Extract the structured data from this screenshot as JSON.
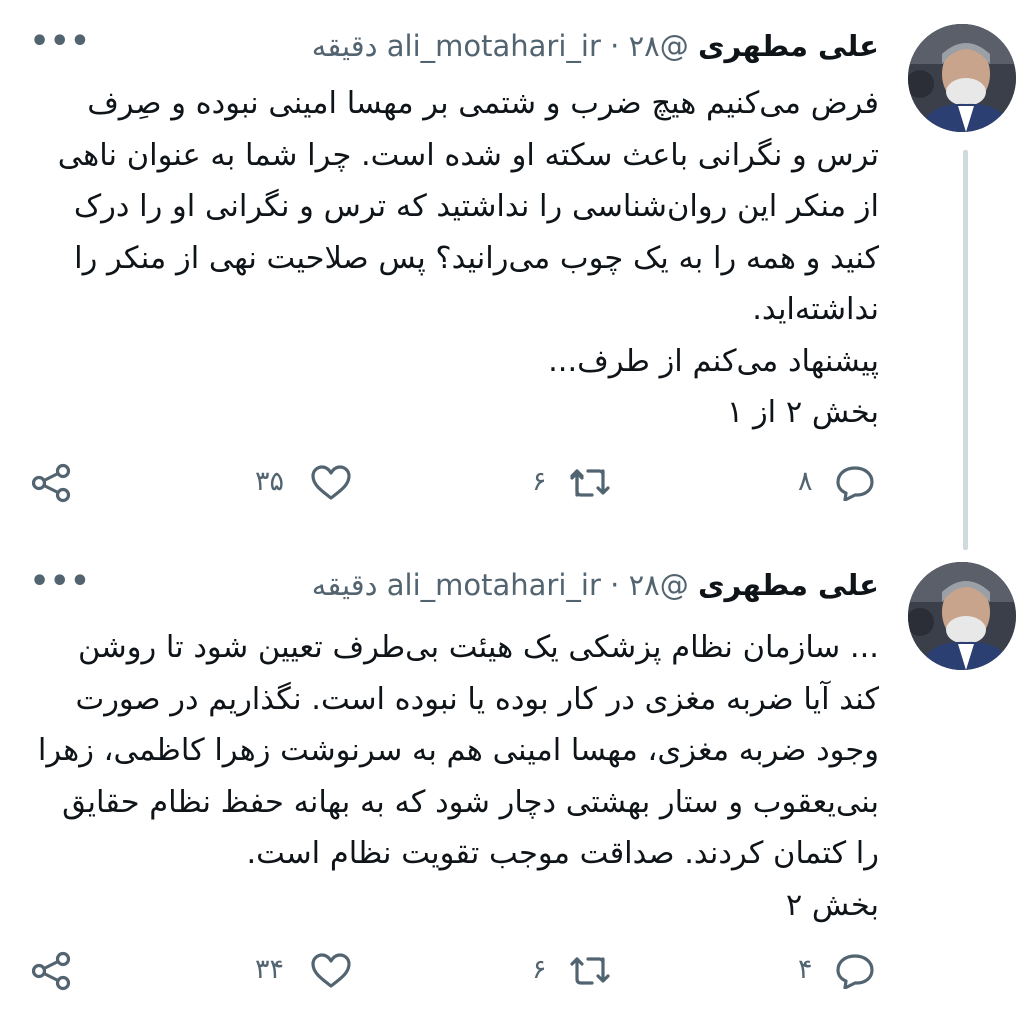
{
  "tweets": [
    {
      "author_name": "علی مطهری",
      "handle": "@ali_motahari_ir",
      "separator": "·",
      "time": "۲۸ دقیقه",
      "more_icon": "more-dots-icon",
      "lines": [
        "فرض می‌کنیم هیچ ضرب و شتمی بر مهسا امینی نبوده و صِرف",
        "ترس و نگرانی باعث سکته او شده است. چرا شما به عنوان ناهی",
        "از منکر این روان‌شناسی را نداشتید که ترس و نگرانی او را درک",
        "کنید و همه را به یک چوب می‌رانید؟ پس صلاحیت نهی از منکر را",
        "نداشته‌اید.",
        "پیشنهاد می‌کنم از طرف...",
        "بخش ۲ از ۱"
      ],
      "replies": "۸",
      "retweets": "۶",
      "likes": "۳۵"
    },
    {
      "author_name": "علی مطهری",
      "handle": "@ali_motahari_ir",
      "separator": "·",
      "time": "۲۸ دقیقه",
      "more_icon": "more-dots-icon",
      "lines": [
        "... سازمان نظام پزشکی یک هیئت بی‌طرف تعیین شود تا روشن",
        "کند آیا ضربه مغزی در کار بوده یا نبوده است. نگذاریم در صورت",
        "وجود ضربه مغزی، مهسا امینی هم به سرنوشت زهرا کاظمی، زهرا",
        "بنی‌یعقوب و ستار بهشتی دچار شود که به بهانه حفظ نظام حقایق",
        "را کتمان کردند. صداقت موجب تقویت نظام است.",
        "بخش ۲"
      ],
      "replies": "۴",
      "retweets": "۶",
      "likes": "۳۴"
    }
  ],
  "colors": {
    "text": "#0f1419",
    "secondary": "#536471",
    "thread_line": "#cfd9de",
    "background": "#ffffff"
  },
  "icons": [
    "reply-icon",
    "retweet-icon",
    "like-icon",
    "share-icon"
  ]
}
